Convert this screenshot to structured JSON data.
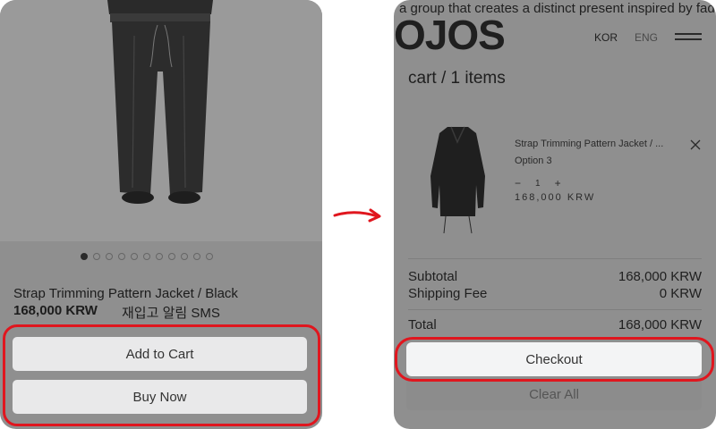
{
  "left_screen": {
    "product": {
      "title": "Strap Trimming Pattern Jacket / Black",
      "price": "168,000 KRW",
      "restock_alert": "재입고 알림 SMS"
    },
    "carousel": {
      "total": 11,
      "active_index": 0
    },
    "buttons": {
      "add_to_cart": "Add to Cart",
      "buy_now": "Buy Now"
    }
  },
  "right_screen": {
    "header": {
      "tagline": "a group that creates a distinct present inspired by faded",
      "logo": "OJOS",
      "lang_kor": "KOR",
      "lang_eng": "ENG"
    },
    "cart": {
      "heading": "cart / 1 items",
      "item": {
        "name": "Strap Trimming Pattern Jacket / ...",
        "option": "Option 3",
        "minus": "−",
        "quantity": "1",
        "plus": "+",
        "price": "168,000 KRW"
      }
    },
    "summary": {
      "subtotal_label": "Subtotal",
      "subtotal_value": "168,000 KRW",
      "shipping_label": "Shipping Fee",
      "shipping_value": "0 KRW",
      "total_label": "Total",
      "total_value": "168,000 KRW"
    },
    "buttons": {
      "checkout": "Checkout",
      "clear_all": "Clear All"
    }
  },
  "colors": {
    "highlight": "#e0161e",
    "overlay_grey": "#8f8f8f",
    "button_grey": "#e9e9ea"
  }
}
